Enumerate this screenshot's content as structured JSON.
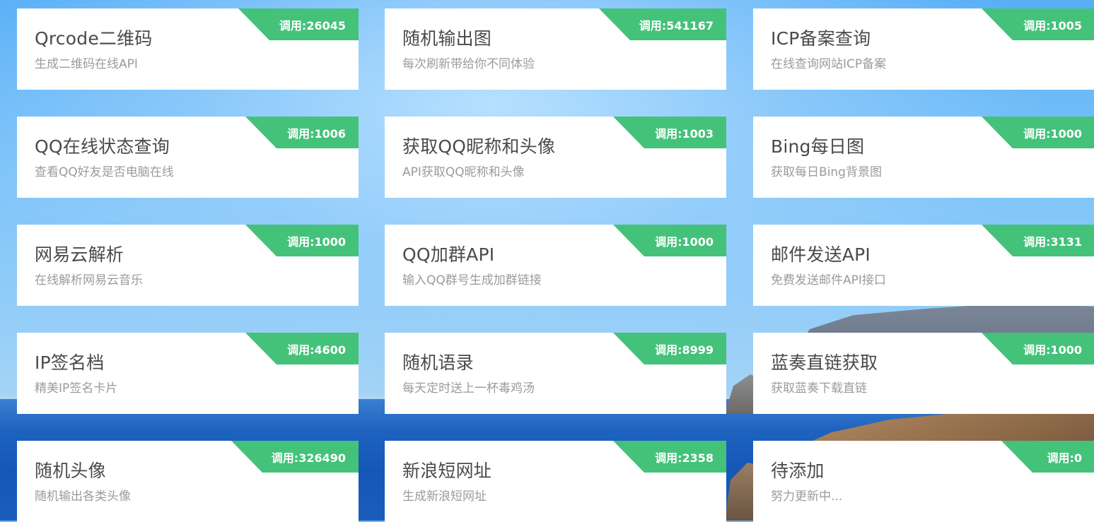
{
  "cards": [
    {
      "title": "Qrcode二维码",
      "desc": "生成二维码在线API",
      "calls": "调用:26045"
    },
    {
      "title": "随机输出图",
      "desc": "每次刷新带给你不同体验",
      "calls": "调用:541167"
    },
    {
      "title": "ICP备案查询",
      "desc": "在线查询网站ICP备案",
      "calls": "调用:1005"
    },
    {
      "title": "QQ在线状态查询",
      "desc": "查看QQ好友是否电脑在线",
      "calls": "调用:1006"
    },
    {
      "title": "获取QQ昵称和头像",
      "desc": "API获取QQ昵称和头像",
      "calls": "调用:1003"
    },
    {
      "title": "Bing每日图",
      "desc": "获取每日Bing背景图",
      "calls": "调用:1000"
    },
    {
      "title": "网易云解析",
      "desc": "在线解析网易云音乐",
      "calls": "调用:1000"
    },
    {
      "title": "QQ加群API",
      "desc": "输入QQ群号生成加群链接",
      "calls": "调用:1000"
    },
    {
      "title": "邮件发送API",
      "desc": "免费发送邮件API接口",
      "calls": "调用:3131"
    },
    {
      "title": "IP签名档",
      "desc": "精美IP签名卡片",
      "calls": "调用:4600"
    },
    {
      "title": "随机语录",
      "desc": "每天定时送上一杯毒鸡汤",
      "calls": "调用:8999"
    },
    {
      "title": "蓝奏直链获取",
      "desc": "获取蓝奏下载直链",
      "calls": "调用:1000"
    },
    {
      "title": "随机头像",
      "desc": "随机输出各类头像",
      "calls": "调用:326490"
    },
    {
      "title": "新浪短网址",
      "desc": "生成新浪短网址",
      "calls": "调用:2358"
    },
    {
      "title": "待添加",
      "desc": "努力更新中...",
      "calls": "调用:0"
    }
  ],
  "theme": {
    "card_background": "#ffffff",
    "badge_color": "#44c27a",
    "title_color": "#4a4a4a",
    "desc_color": "#9b9b9b"
  }
}
